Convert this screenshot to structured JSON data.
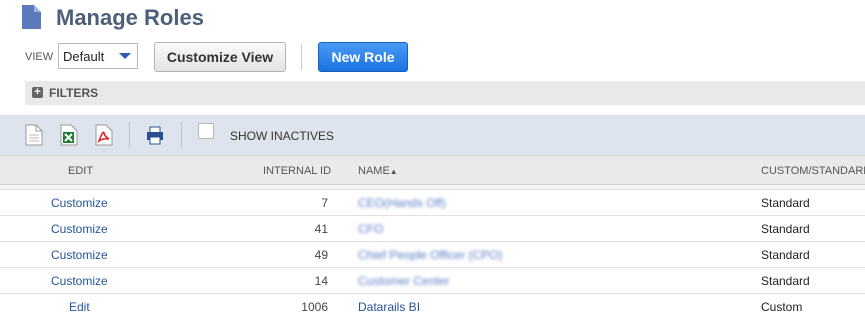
{
  "page": {
    "title": "Manage Roles"
  },
  "view": {
    "label": "VIEW",
    "selected": "Default"
  },
  "buttons": {
    "customize_view": "Customize View",
    "new_role": "New Role"
  },
  "filters": {
    "label": "FILTERS"
  },
  "toolbar": {
    "show_inactives": "SHOW INACTIVES"
  },
  "table": {
    "headers": {
      "edit": "EDIT",
      "internal_id": "INTERNAL ID",
      "name": "NAME",
      "custom_standard": "CUSTOM/STANDARD"
    },
    "rows": [
      {
        "edit": "Customize",
        "internal_id": "7",
        "name": "CEO(Hands Off)",
        "type": "Standard"
      },
      {
        "edit": "Customize",
        "internal_id": "41",
        "name": "CFO",
        "type": "Standard"
      },
      {
        "edit": "Customize",
        "internal_id": "49",
        "name": "Chief People Officer (CPO)",
        "type": "Standard"
      },
      {
        "edit": "Customize",
        "internal_id": "14",
        "name": "Customer Center",
        "type": "Standard"
      },
      {
        "edit": "Edit",
        "internal_id": "1006",
        "name": "Datarails BI",
        "type": "Custom"
      }
    ]
  },
  "colors": {
    "title": "#4d5f79",
    "link": "#255599",
    "primary_button": "#1a73e0",
    "toolbar_bg": "#dde4ee"
  }
}
